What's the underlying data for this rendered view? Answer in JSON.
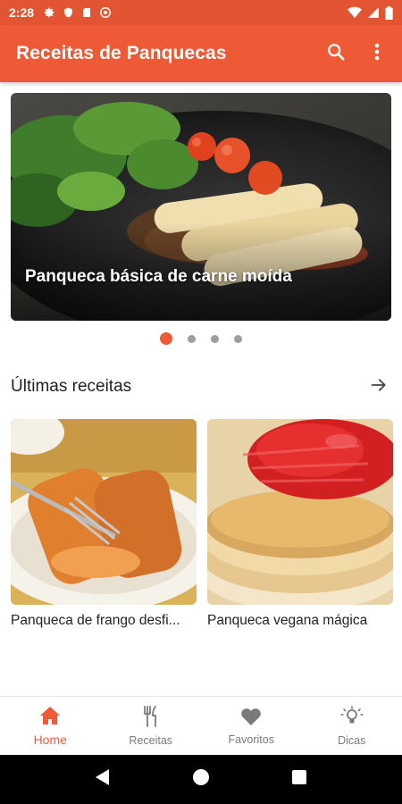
{
  "status_bar": {
    "time": "2:28",
    "left_icons": [
      "gear-icon",
      "shield-icon",
      "sd-card-icon",
      "at-sign-icon"
    ],
    "right_icons": [
      "wifi-icon",
      "signal-icon",
      "battery-icon"
    ]
  },
  "app_bar": {
    "title": "Receitas de Panquecas",
    "actions": [
      "search-icon",
      "more-vert-icon"
    ],
    "color": "#EE5A35"
  },
  "carousel": {
    "caption": "Panqueca básica de carne moída",
    "page_count": 4,
    "active_index": 0
  },
  "latest": {
    "title": "Últimas receitas",
    "cards": [
      {
        "title": "Panqueca de frango desfi..."
      },
      {
        "title": "Panqueca vegana mágica"
      }
    ]
  },
  "bottom_nav": {
    "items": [
      {
        "label": "Home",
        "icon": "home-icon",
        "active": true
      },
      {
        "label": "Receitas",
        "icon": "fork-knife-icon",
        "active": false
      },
      {
        "label": "Favoritos",
        "icon": "heart-icon",
        "active": false
      },
      {
        "label": "Dicas",
        "icon": "lightbulb-icon",
        "active": false
      }
    ]
  },
  "system_nav": [
    "back-icon",
    "home-circle-icon",
    "recents-icon"
  ],
  "colors": {
    "accent": "#EE5A35",
    "status_bar": "#E35532",
    "inactive": "#7a7a7a"
  }
}
